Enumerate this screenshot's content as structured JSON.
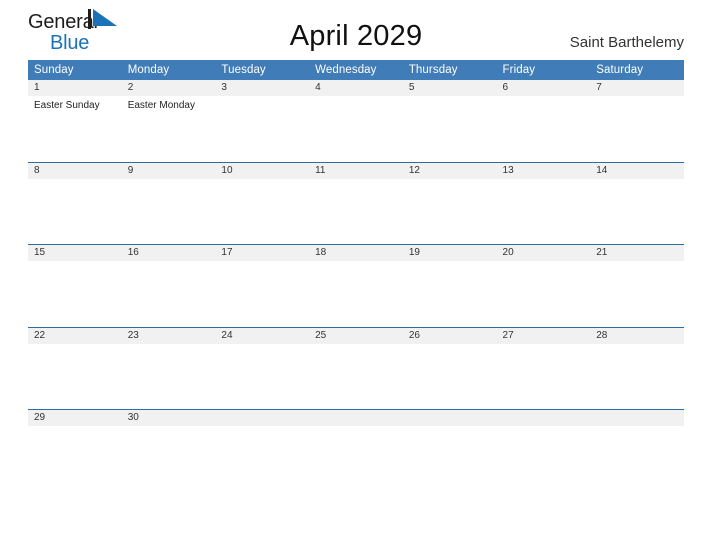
{
  "brand": {
    "name_part1": "General",
    "name_part2": "Blue",
    "flag_icon": "blue-triangle-flag-icon",
    "colors": {
      "dark": "#1d1d1d",
      "blue": "#1c72b8"
    }
  },
  "header": {
    "title": "April 2029",
    "region": "Saint Barthelemy"
  },
  "colors": {
    "header_blue": "#3f7cb8",
    "row_divider_blue": "#2e6da4",
    "daynum_band_gray": "#f1f1f1",
    "text": "#222222"
  },
  "calendar": {
    "weekday_headers": [
      "Sunday",
      "Monday",
      "Tuesday",
      "Wednesday",
      "Thursday",
      "Friday",
      "Saturday"
    ],
    "weeks": [
      {
        "days": [
          {
            "num": "1",
            "events": [
              "Easter Sunday"
            ]
          },
          {
            "num": "2",
            "events": [
              "Easter Monday"
            ]
          },
          {
            "num": "3",
            "events": []
          },
          {
            "num": "4",
            "events": []
          },
          {
            "num": "5",
            "events": []
          },
          {
            "num": "6",
            "events": []
          },
          {
            "num": "7",
            "events": []
          }
        ]
      },
      {
        "days": [
          {
            "num": "8",
            "events": []
          },
          {
            "num": "9",
            "events": []
          },
          {
            "num": "10",
            "events": []
          },
          {
            "num": "11",
            "events": []
          },
          {
            "num": "12",
            "events": []
          },
          {
            "num": "13",
            "events": []
          },
          {
            "num": "14",
            "events": []
          }
        ]
      },
      {
        "days": [
          {
            "num": "15",
            "events": []
          },
          {
            "num": "16",
            "events": []
          },
          {
            "num": "17",
            "events": []
          },
          {
            "num": "18",
            "events": []
          },
          {
            "num": "19",
            "events": []
          },
          {
            "num": "20",
            "events": []
          },
          {
            "num": "21",
            "events": []
          }
        ]
      },
      {
        "days": [
          {
            "num": "22",
            "events": []
          },
          {
            "num": "23",
            "events": []
          },
          {
            "num": "24",
            "events": []
          },
          {
            "num": "25",
            "events": []
          },
          {
            "num": "26",
            "events": []
          },
          {
            "num": "27",
            "events": []
          },
          {
            "num": "28",
            "events": []
          }
        ]
      },
      {
        "days": [
          {
            "num": "29",
            "events": []
          },
          {
            "num": "30",
            "events": []
          },
          {
            "num": "",
            "events": []
          },
          {
            "num": "",
            "events": []
          },
          {
            "num": "",
            "events": []
          },
          {
            "num": "",
            "events": []
          },
          {
            "num": "",
            "events": []
          }
        ]
      }
    ]
  }
}
